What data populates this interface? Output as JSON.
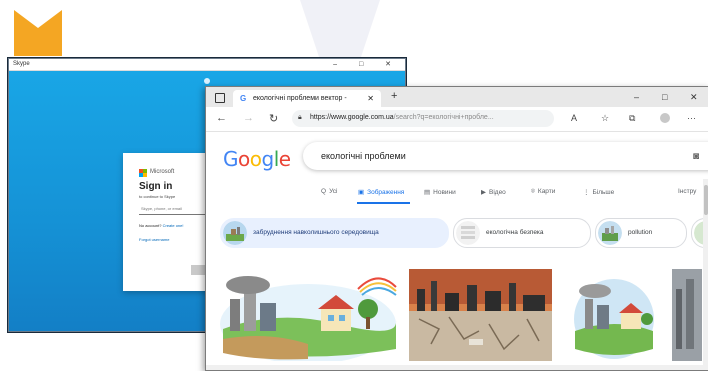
{
  "skype_window": {
    "title": "Skype",
    "controls": [
      "–",
      "□",
      "✕"
    ],
    "signin": {
      "brand": "Microsoft",
      "heading": "Sign in",
      "subtitle": "to continue to Skype",
      "field_placeholder": "Skype, phone, or email",
      "no_account": "No account?",
      "create_one": "Create one!",
      "forgot": "Forgot username"
    }
  },
  "browser": {
    "tab_title": "екологічні проблеми вектор -",
    "tab_close": "✕",
    "new_tab": "+",
    "window_controls": [
      "–",
      "□",
      "✕"
    ],
    "url_host": "https://www.google.com.ua",
    "url_path": "/search?q=екологічні+пробле...",
    "toolbar_icons": [
      "read-aloud-icon",
      "favorites-icon",
      "collections-icon",
      "profile-icon",
      "more-icon"
    ],
    "more_label": "···"
  },
  "google": {
    "logo": [
      "G",
      "o",
      "o",
      "g",
      "l",
      "e"
    ],
    "query": "екологічні проблеми",
    "tabs": [
      {
        "icon": "Q",
        "label": "Усі"
      },
      {
        "icon": "▣",
        "label": "Зображення"
      },
      {
        "icon": "▤",
        "label": "Новини"
      },
      {
        "icon": "▶",
        "label": "Відео"
      },
      {
        "icon": "⌾",
        "label": "Карти"
      },
      {
        "icon": "⋮",
        "label": "Більше"
      },
      {
        "icon": "",
        "label": "Інстру"
      }
    ],
    "chips": [
      {
        "label": "забруднення навколишнього середовища",
        "selected": true
      },
      {
        "label": "екологічна безпека",
        "selected": false
      },
      {
        "label": "pollution",
        "selected": false
      }
    ]
  },
  "colors": {
    "skype_blue": "#1591d5",
    "google_blue": "#1a73e8",
    "corner_accent": "#f4a623"
  }
}
